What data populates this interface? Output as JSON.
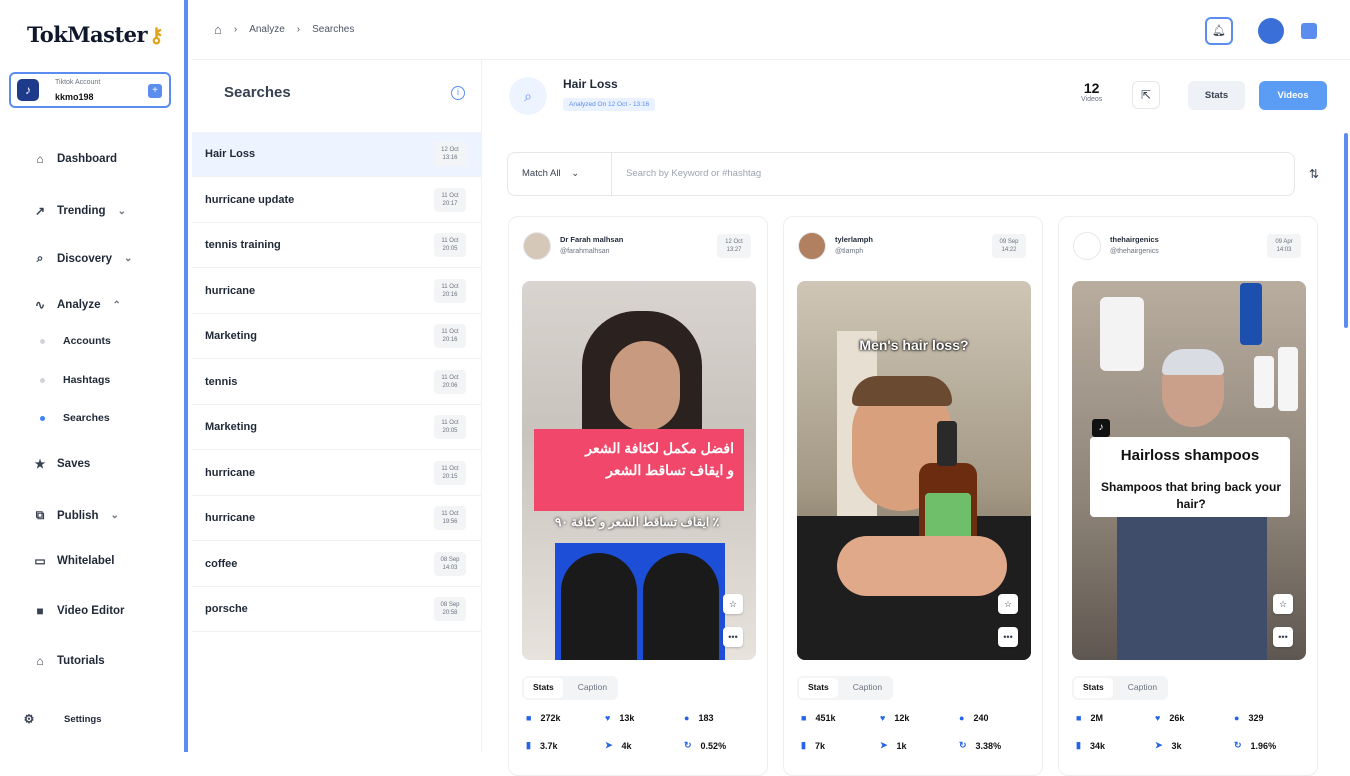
{
  "app": {
    "logo": "TokMaster",
    "logo_icon": "key-icon"
  },
  "account": {
    "label": "Tiktok Account",
    "handle": "kkmo198",
    "add": "+"
  },
  "nav": [
    {
      "label": "Dashboard",
      "icon": "home-icon"
    },
    {
      "label": "Trending",
      "icon": "trend-icon"
    },
    {
      "label": "Discovery",
      "icon": "search-icon"
    },
    {
      "label": "Analyze",
      "icon": "pulse-icon"
    },
    {
      "label": "Saves",
      "icon": "star-icon"
    },
    {
      "label": "Publish",
      "icon": "publish-icon"
    },
    {
      "label": "Whitelabel",
      "icon": "monitor-icon"
    },
    {
      "label": "Video Editor",
      "icon": "video-icon"
    },
    {
      "label": "Tutorials",
      "icon": "graduation-icon"
    },
    {
      "label": "Settings",
      "icon": "gear-icon"
    }
  ],
  "analyze_sub": [
    {
      "label": "Accounts"
    },
    {
      "label": "Hashtags"
    },
    {
      "label": "Searches"
    }
  ],
  "breadcrumb": {
    "home_icon": "home-icon",
    "level1": "Analyze",
    "level2": "Searches"
  },
  "searches": {
    "title": "Searches",
    "items": [
      {
        "name": "Hair Loss",
        "date": "12 Oct",
        "time": "13:16"
      },
      {
        "name": "hurricane update",
        "date": "11 Oct",
        "time": "20:17"
      },
      {
        "name": "tennis training",
        "date": "11 Oct",
        "time": "20:05"
      },
      {
        "name": "hurricane",
        "date": "11 Oct",
        "time": "20:16"
      },
      {
        "name": "Marketing",
        "date": "11 Oct",
        "time": "20:16"
      },
      {
        "name": "tennis",
        "date": "11 Oct",
        "time": "20:06"
      },
      {
        "name": "Marketing",
        "date": "11 Oct",
        "time": "20:05"
      },
      {
        "name": "hurricane",
        "date": "11 Oct",
        "time": "20:15"
      },
      {
        "name": "hurricane",
        "date": "11 Oct",
        "time": "19:56"
      },
      {
        "name": "coffee",
        "date": "08 Sep",
        "time": "14:03"
      },
      {
        "name": "porsche",
        "date": "08 Sep",
        "time": "20:58"
      }
    ]
  },
  "header": {
    "title": "Hair Loss",
    "badge": "Analyzed On 12 Oct - 13:16",
    "count": "12",
    "count_label": "Videos",
    "stats_btn": "Stats",
    "videos_btn": "Videos"
  },
  "filter": {
    "match": "Match All",
    "placeholder": "Search by Keyword or #hashtag"
  },
  "cards": [
    {
      "user": "Dr Farah malhsan",
      "handle": "@farahmalhsan",
      "date": "12 Oct",
      "time": "13:27",
      "overlay_top": "افضل مكمل لكثافة الشعر",
      "overlay_mid": "و ايقاف تساقط الشعر",
      "overlay_low": "ايقاف تساقط الشعر و كثافة ٩٠ ٪",
      "tab_stats": "Stats",
      "tab_caption": "Caption",
      "views": "272k",
      "likes": "13k",
      "comments": "183",
      "saves": "3.7k",
      "shares": "4k",
      "rate": "0.52%"
    },
    {
      "user": "tylerlamph",
      "handle": "@tlamph",
      "date": "09 Sep",
      "time": "14:22",
      "overlay_top": "Men's hair loss?",
      "tab_stats": "Stats",
      "tab_caption": "Caption",
      "views": "451k",
      "likes": "12k",
      "comments": "240",
      "saves": "7k",
      "shares": "1k",
      "rate": "3.38%"
    },
    {
      "user": "thehairgenics",
      "handle": "@thehairgenics",
      "date": "09 Apr",
      "time": "14:03",
      "overlay_top": "Hairloss shampoos",
      "overlay_mid": "Shampoos that bring back your hair?",
      "tab_stats": "Stats",
      "tab_caption": "Caption",
      "views": "2M",
      "likes": "26k",
      "comments": "329",
      "saves": "34k",
      "shares": "3k",
      "rate": "1.96%"
    }
  ]
}
